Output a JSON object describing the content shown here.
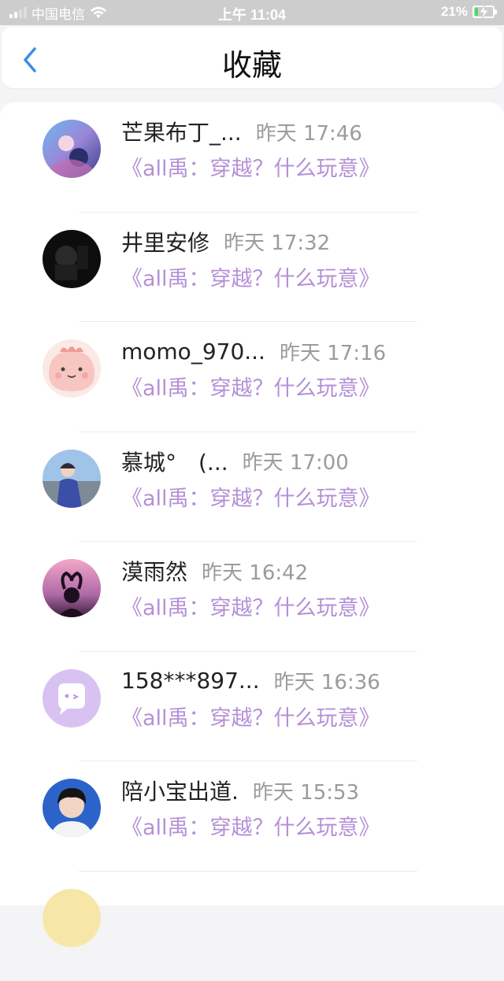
{
  "status_bar": {
    "carrier": "中国电信",
    "time": "上午 11:04",
    "battery": "21%",
    "battery_level": 0.21
  },
  "header": {
    "title": "收藏",
    "back_icon": "chevron-left-icon"
  },
  "items": [
    {
      "name": "芒果布丁_...",
      "time": "昨天 17:46",
      "title": "《all禹：穿越？什么玩意》"
    },
    {
      "name": "井里安修",
      "time": "昨天 17:32",
      "title": "《all禹：穿越？什么玩意》"
    },
    {
      "name": "momo_970...",
      "time": "昨天 17:16",
      "title": "《all禹：穿越？什么玩意》"
    },
    {
      "name": "慕城°　(...",
      "time": "昨天 17:00",
      "title": "《all禹：穿越？什么玩意》"
    },
    {
      "name": "漠雨然",
      "time": "昨天 16:42",
      "title": "《all禹：穿越？什么玩意》"
    },
    {
      "name": "158***897...",
      "time": "昨天 16:36",
      "title": "《all禹：穿越？什么玩意》"
    },
    {
      "name": "陪小宝出道.",
      "time": "昨天 15:53",
      "title": "《all禹：穿越？什么玩意》"
    }
  ],
  "colors": {
    "accent": "#3a8ee6",
    "link": "#b490d6",
    "time": "#9b9b9b"
  }
}
